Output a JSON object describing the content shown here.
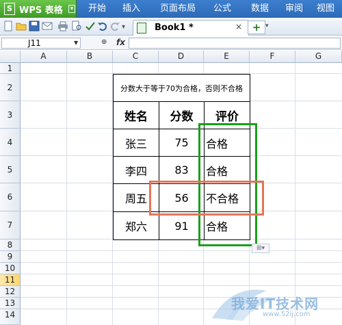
{
  "app": {
    "name": "WPS 表格",
    "logo_letter": "S",
    "dropdown": "▾"
  },
  "menu": [
    "开始",
    "插入",
    "页面布局",
    "公式",
    "数据",
    "审阅",
    "视图"
  ],
  "toolbar": {
    "icons": [
      "new-file-icon",
      "open-folder-icon",
      "save-icon",
      "email-icon",
      "print-icon",
      "print-preview-icon",
      "spellcheck-icon",
      "undo-icon",
      "redo-icon"
    ],
    "doc_tab": "Book1 *",
    "close_glyph": "×",
    "new_tab_glyph": "+"
  },
  "formula_bar": {
    "name_box": "J11",
    "zoom_glyph": "⊕",
    "fx_label": "fx",
    "formula": ""
  },
  "grid": {
    "columns": [
      "A",
      "B",
      "C",
      "D",
      "E",
      "F",
      "G"
    ],
    "rows": [
      "1",
      "2",
      "3",
      "4",
      "5",
      "6",
      "7",
      "8",
      "9",
      "10",
      "11",
      "12",
      "13",
      "14"
    ],
    "selected_row": "11"
  },
  "table": {
    "note": "分数大于等于70为合格，否则不合格",
    "headers": [
      "姓名",
      "分数",
      "评价"
    ],
    "rows": [
      [
        "张三",
        "75",
        "合格"
      ],
      [
        "李四",
        "83",
        "合格"
      ],
      [
        "周五",
        "56",
        "不合格"
      ],
      [
        "郑六",
        "91",
        "合格"
      ]
    ]
  },
  "paste_options_glyph": "⊞▾",
  "watermark": {
    "text": "我爱IT技术网",
    "url": "www.52ij.com"
  },
  "colors": {
    "menubar": "#2d6ab8",
    "app_button": "#4fae32",
    "highlight_green": "#1a9e1a",
    "highlight_orange": "#e0765a",
    "selected_row": "#ffd66e"
  }
}
